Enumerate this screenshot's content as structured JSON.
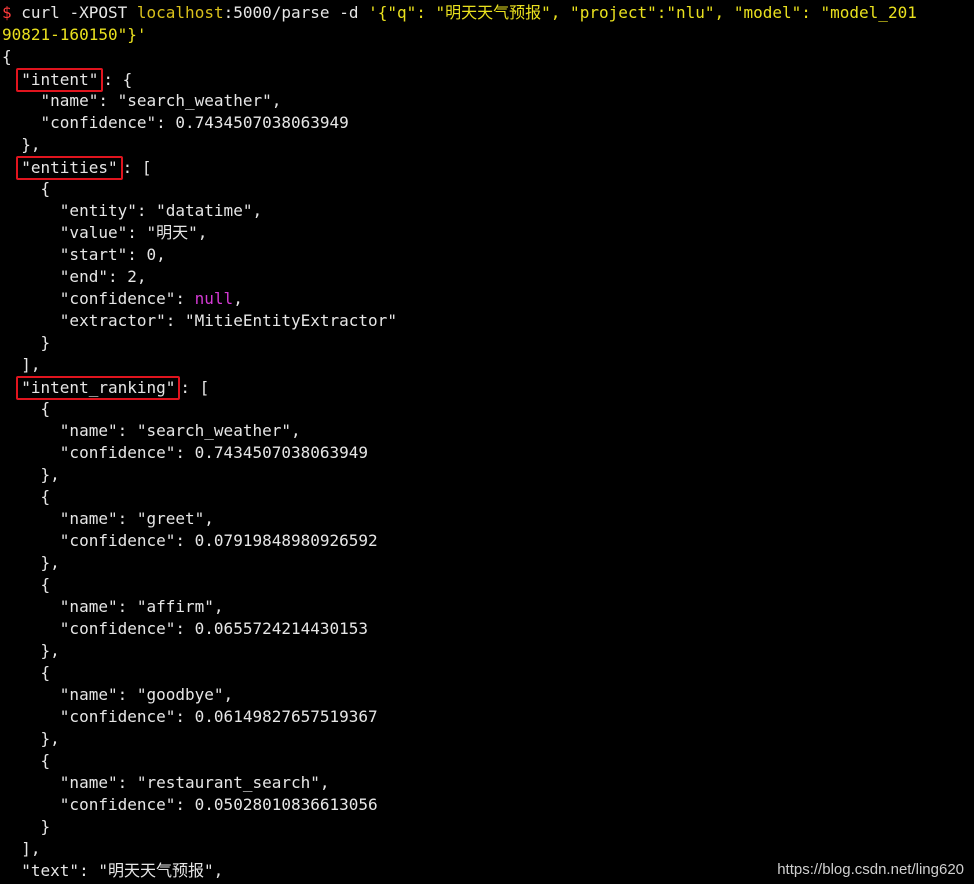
{
  "terminal": {
    "prompt_symbol": "$",
    "command_name": "curl",
    "command_flag": "-XPOST",
    "command_host": "localhost",
    "command_path": ":5000/parse -d",
    "command_body_1": "'{\"q\": \"明天天气预报\", \"project\":\"nlu\", \"model\": \"model_201",
    "command_body_2": "90821-160150\"}'"
  },
  "json_output": {
    "open_brace": "{",
    "intent_key": "\"intent\"",
    "intent_rest": ": {",
    "intent_name": "\"name\": \"search_weather\",",
    "intent_conf": "\"confidence\": 0.7434507038063949",
    "intent_close": "},",
    "entities_key": "\"entities\"",
    "entities_rest": ": [",
    "entity_open": "{",
    "entity_entity": "\"entity\": \"datatime\",",
    "entity_value": "\"value\": \"明天\",",
    "entity_start": "\"start\": 0,",
    "entity_end": "\"end\": 2,",
    "entity_conf_key": "\"confidence\": ",
    "entity_conf_val": "null",
    "entity_conf_comma": ",",
    "entity_extractor": "\"extractor\": \"MitieEntityExtractor\"",
    "entity_close": "}",
    "entities_close": "],",
    "ranking_key": "\"intent_ranking\"",
    "ranking_rest": ": [",
    "ranking": [
      {
        "name": "\"name\": \"search_weather\",",
        "conf": "\"confidence\": 0.7434507038063949"
      },
      {
        "name": "\"name\": \"greet\",",
        "conf": "\"confidence\": 0.07919848980926592"
      },
      {
        "name": "\"name\": \"affirm\",",
        "conf": "\"confidence\": 0.0655724214430153"
      },
      {
        "name": "\"name\": \"goodbye\",",
        "conf": "\"confidence\": 0.06149827657519367"
      },
      {
        "name": "\"name\": \"restaurant_search\",",
        "conf": "\"confidence\": 0.05028010836613056"
      }
    ],
    "obj_open": "{",
    "obj_close_comma": "},",
    "obj_close": "}",
    "ranking_close": "],",
    "text_line": "\"text\": \"明天天气预报\","
  },
  "watermark": "https://blog.csdn.net/ling620",
  "colors": {
    "highlight_box": "#e0141e",
    "prompt": "#ff3b3b",
    "host": "#d9c01b",
    "null": "#d43ad4"
  }
}
